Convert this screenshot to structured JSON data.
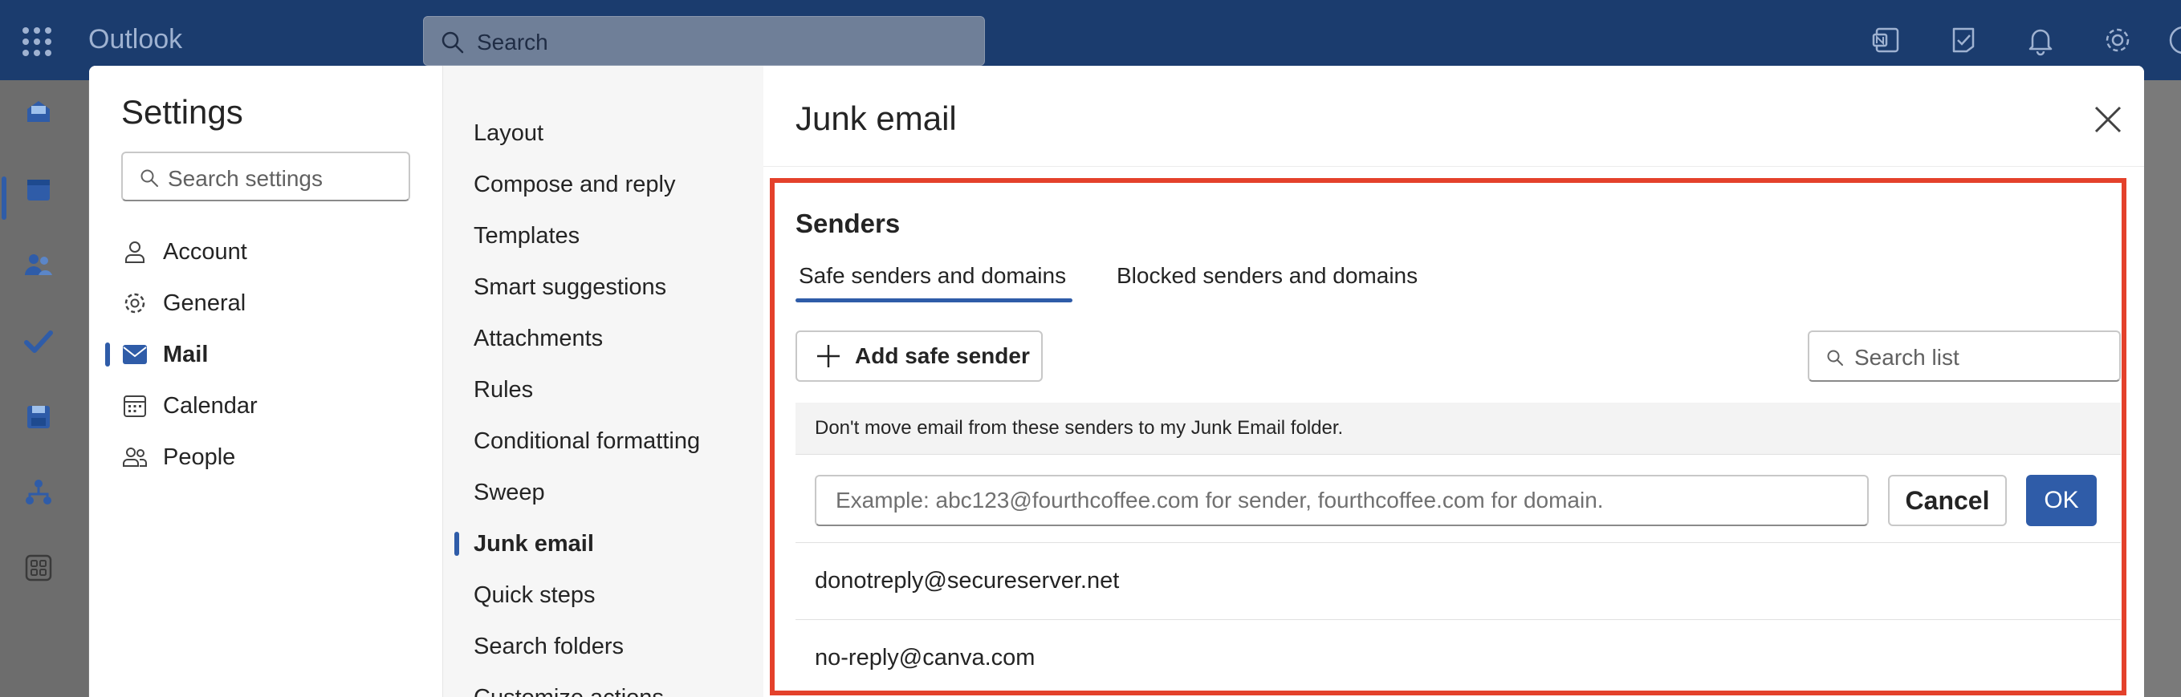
{
  "app": {
    "title": "Outlook"
  },
  "topbar": {
    "search_placeholder": "Search"
  },
  "settings": {
    "title": "Settings",
    "search_placeholder": "Search settings",
    "categories": [
      {
        "label": "Account",
        "icon": "person-icon"
      },
      {
        "label": "General",
        "icon": "gear-icon"
      },
      {
        "label": "Mail",
        "icon": "mail-icon",
        "active": true
      },
      {
        "label": "Calendar",
        "icon": "calendar-icon"
      },
      {
        "label": "People",
        "icon": "people-icon"
      }
    ],
    "mail_sections": [
      "Layout",
      "Compose and reply",
      "Templates",
      "Smart suggestions",
      "Attachments",
      "Rules",
      "Conditional formatting",
      "Sweep",
      "Junk email",
      "Quick steps",
      "Search folders",
      "Customize actions"
    ],
    "active_section": "Junk email"
  },
  "junk": {
    "title": "Junk email",
    "senders_heading": "Senders",
    "tabs": {
      "safe": "Safe senders and domains",
      "blocked": "Blocked senders and domains"
    },
    "add_button": "Add safe sender",
    "list_search_placeholder": "Search list",
    "info_text": "Don't move email from these senders to my Junk Email folder.",
    "input_placeholder": "Example: abc123@fourthcoffee.com for sender, fourthcoffee.com for domain.",
    "cancel_label": "Cancel",
    "ok_label": "OK",
    "senders": [
      "donotreply@secureserver.net",
      "no-reply@canva.com"
    ]
  },
  "colors": {
    "accent": "#2f5ca8",
    "topbar": "#1b3c6e",
    "highlight": "#e4412b"
  }
}
